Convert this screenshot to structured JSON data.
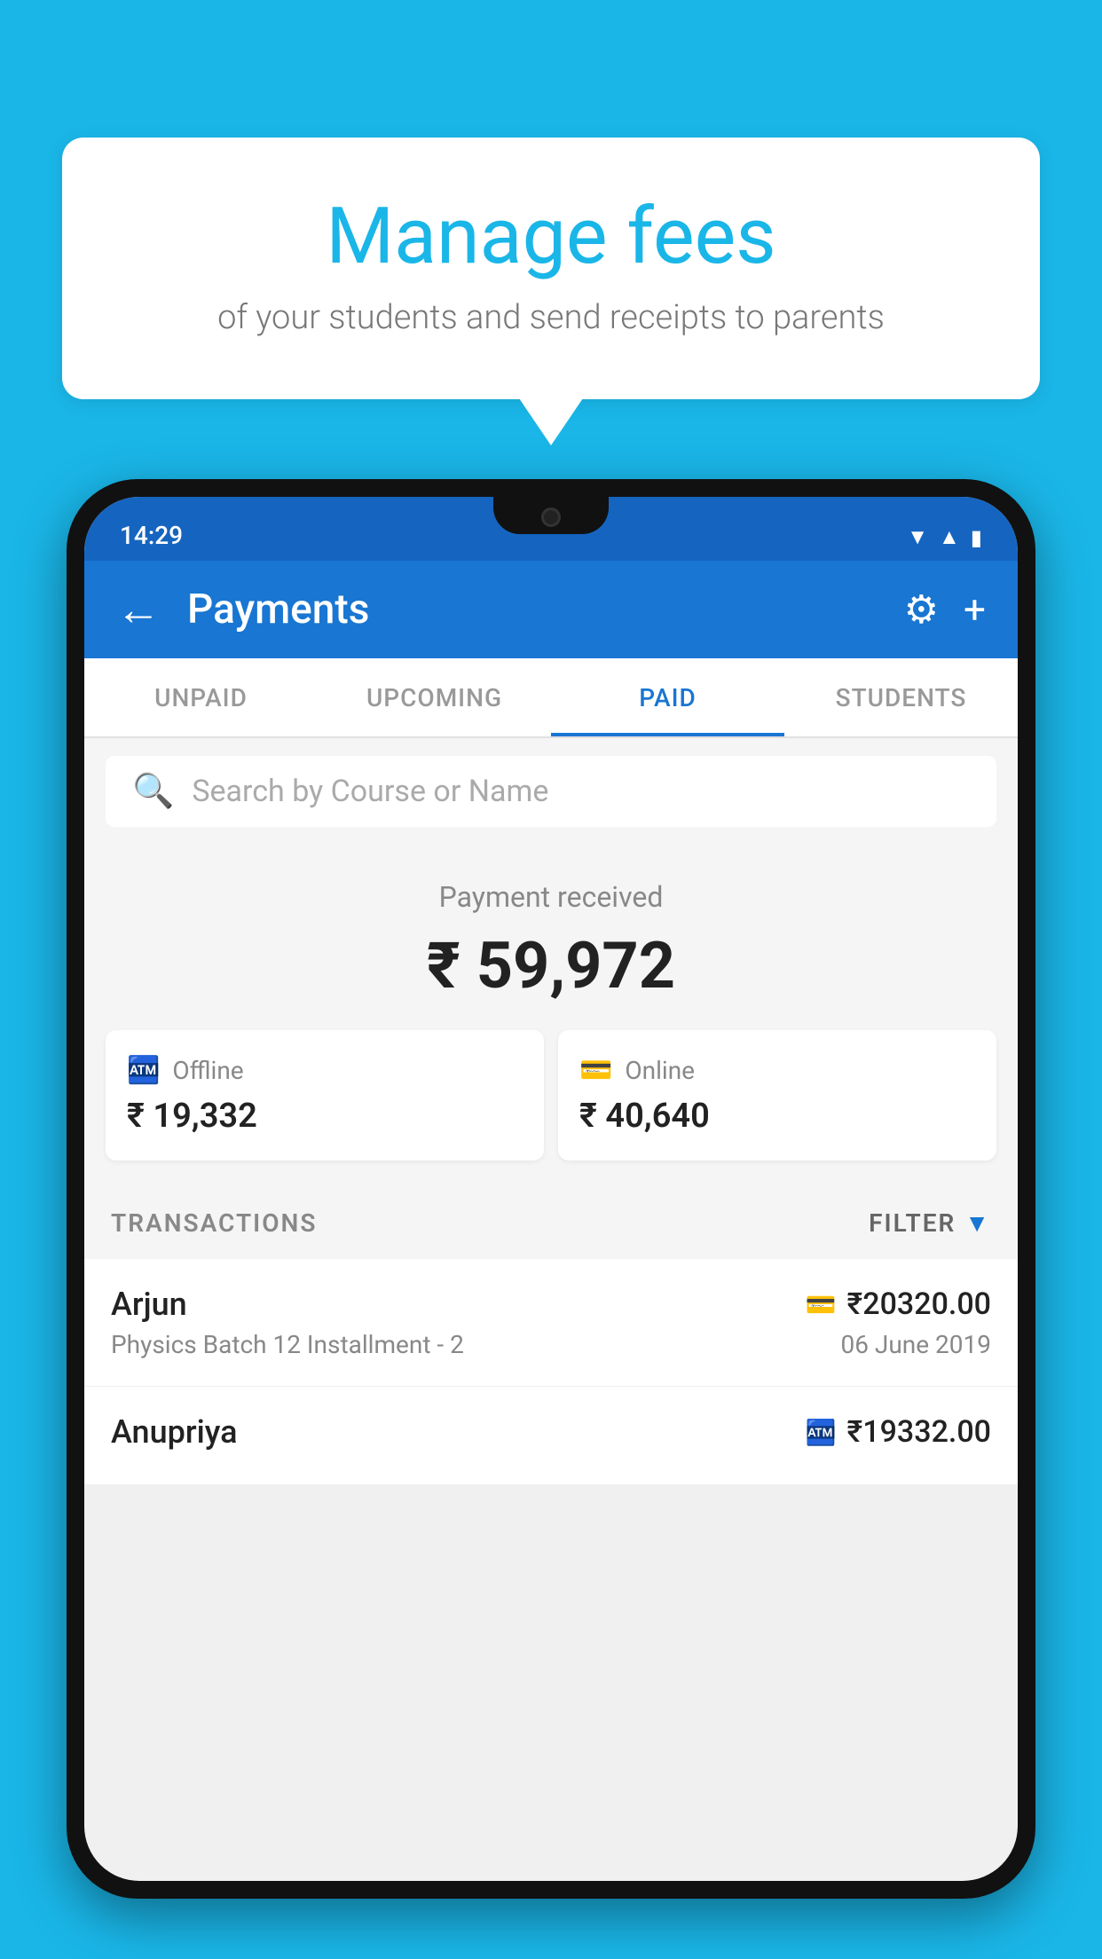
{
  "background_color": "#1ab6e8",
  "speech_bubble": {
    "title": "Manage fees",
    "subtitle": "of your students and send receipts to parents"
  },
  "status_bar": {
    "time": "14:29",
    "icons": [
      "wifi",
      "signal",
      "battery"
    ]
  },
  "app_bar": {
    "title": "Payments",
    "back_label": "←",
    "settings_label": "⚙",
    "add_label": "+"
  },
  "tabs": [
    {
      "id": "unpaid",
      "label": "UNPAID",
      "active": false
    },
    {
      "id": "upcoming",
      "label": "UPCOMING",
      "active": false
    },
    {
      "id": "paid",
      "label": "PAID",
      "active": true
    },
    {
      "id": "students",
      "label": "STUDENTS",
      "active": false
    }
  ],
  "search": {
    "placeholder": "Search by Course or Name"
  },
  "payment_summary": {
    "received_label": "Payment received",
    "total_amount": "₹ 59,972",
    "offline_label": "Offline",
    "offline_amount": "₹ 19,332",
    "online_label": "Online",
    "online_amount": "₹ 40,640"
  },
  "transactions_section": {
    "label": "TRANSACTIONS",
    "filter_label": "FILTER"
  },
  "transactions": [
    {
      "name": "Arjun",
      "course": "Physics Batch 12 Installment - 2",
      "amount": "₹20320.00",
      "date": "06 June 2019",
      "payment_type": "online"
    },
    {
      "name": "Anupriya",
      "course": "",
      "amount": "₹19332.00",
      "date": "",
      "payment_type": "offline"
    }
  ]
}
